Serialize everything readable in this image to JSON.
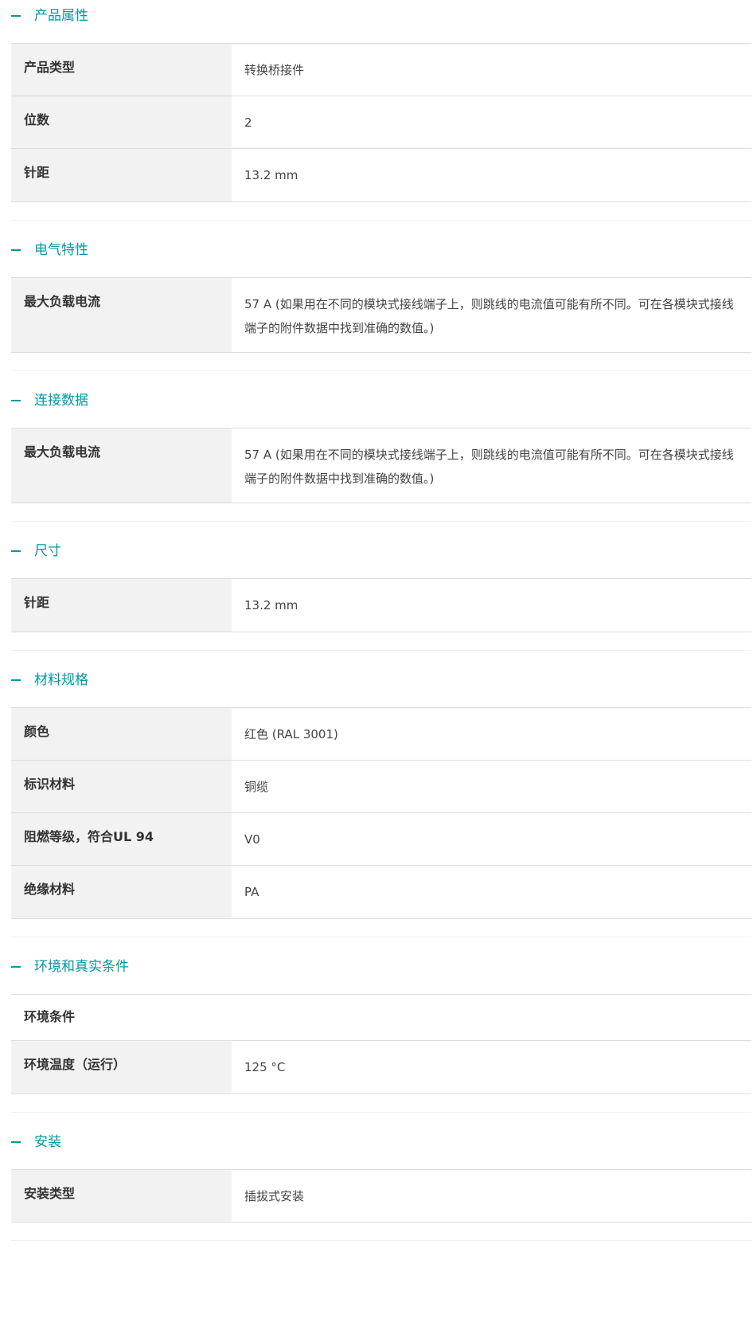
{
  "sections": [
    {
      "title": "产品属性",
      "rows": [
        {
          "k": "产品类型",
          "v": "转换桥接件"
        },
        {
          "k": "位数",
          "v": "2"
        },
        {
          "k": "针距",
          "v": "13.2 mm"
        }
      ]
    },
    {
      "title": "电气特性",
      "rows": [
        {
          "k": "最大负载电流",
          "v": "57 A (如果用在不同的模块式接线端子上，则跳线的电流值可能有所不同。可在各模块式接线端子的附件数据中找到准确的数值。)"
        }
      ]
    },
    {
      "title": "连接数据",
      "rows": [
        {
          "k": "最大负载电流",
          "v": "57 A (如果用在不同的模块式接线端子上，则跳线的电流值可能有所不同。可在各模块式接线端子的附件数据中找到准确的数值。)"
        }
      ]
    },
    {
      "title": "尺寸",
      "rows": [
        {
          "k": "针距",
          "v": "13.2 mm"
        }
      ]
    },
    {
      "title": "材料规格",
      "rows": [
        {
          "k": "颜色",
          "v": "红色 (RAL 3001)"
        },
        {
          "k": "标识材料",
          "v": "铜缆"
        },
        {
          "k": "阻燃等级，符合UL 94",
          "v": "V0"
        },
        {
          "k": "绝缘材料",
          "v": "PA"
        }
      ]
    },
    {
      "title": "环境和真实条件",
      "rows": [
        {
          "k": "环境条件",
          "v": ""
        },
        {
          "k": "环境温度（运行）",
          "v": "125 °C"
        }
      ]
    },
    {
      "title": "安装",
      "rows": [
        {
          "k": "安装类型",
          "v": "插拔式安装"
        }
      ]
    }
  ],
  "accent_color": "#0098a1",
  "collapse_icon": "minus-icon"
}
